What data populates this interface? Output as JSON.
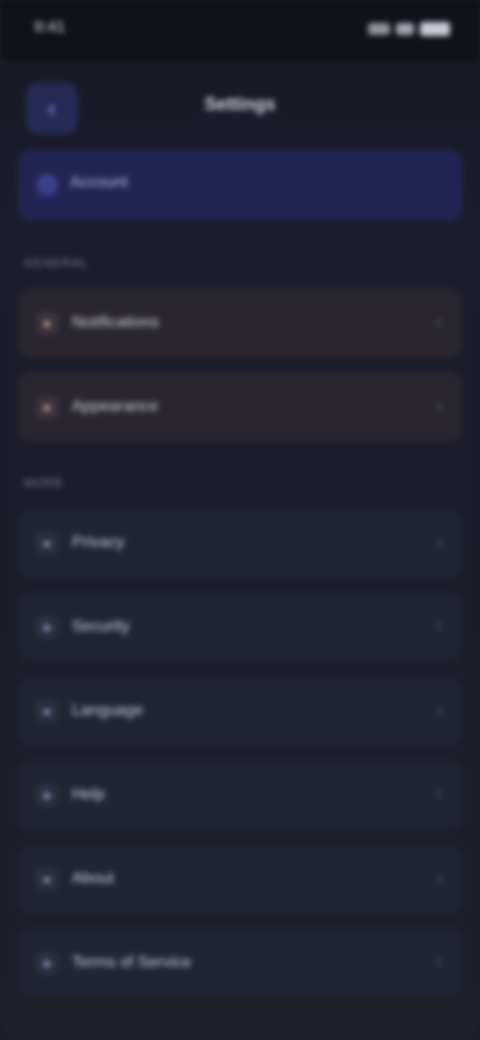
{
  "status_bar": {
    "time": "9:41",
    "icons": [
      "signal-icon",
      "wifi-icon",
      "battery-icon"
    ]
  },
  "header": {
    "back_icon": "chevron-left-icon",
    "title": "Settings"
  },
  "banner": {
    "label": "Account"
  },
  "sections": [
    {
      "label": "General"
    },
    {
      "label": "More"
    }
  ],
  "warm_items": [
    {
      "label": "Notifications",
      "icon": "bell-icon"
    },
    {
      "label": "Appearance",
      "icon": "palette-icon"
    }
  ],
  "cool_items": [
    {
      "label": "Privacy",
      "icon": "lock-icon"
    },
    {
      "label": "Security",
      "icon": "shield-icon"
    },
    {
      "label": "Language",
      "icon": "globe-icon"
    },
    {
      "label": "Help",
      "icon": "help-icon"
    },
    {
      "label": "About",
      "icon": "info-icon"
    },
    {
      "label": "Terms of Service",
      "icon": "document-icon"
    }
  ],
  "colors": {
    "background": "#1b1c28",
    "accent": "#262a55",
    "warm_card": "#2a2630",
    "cool_card": "#212533"
  }
}
